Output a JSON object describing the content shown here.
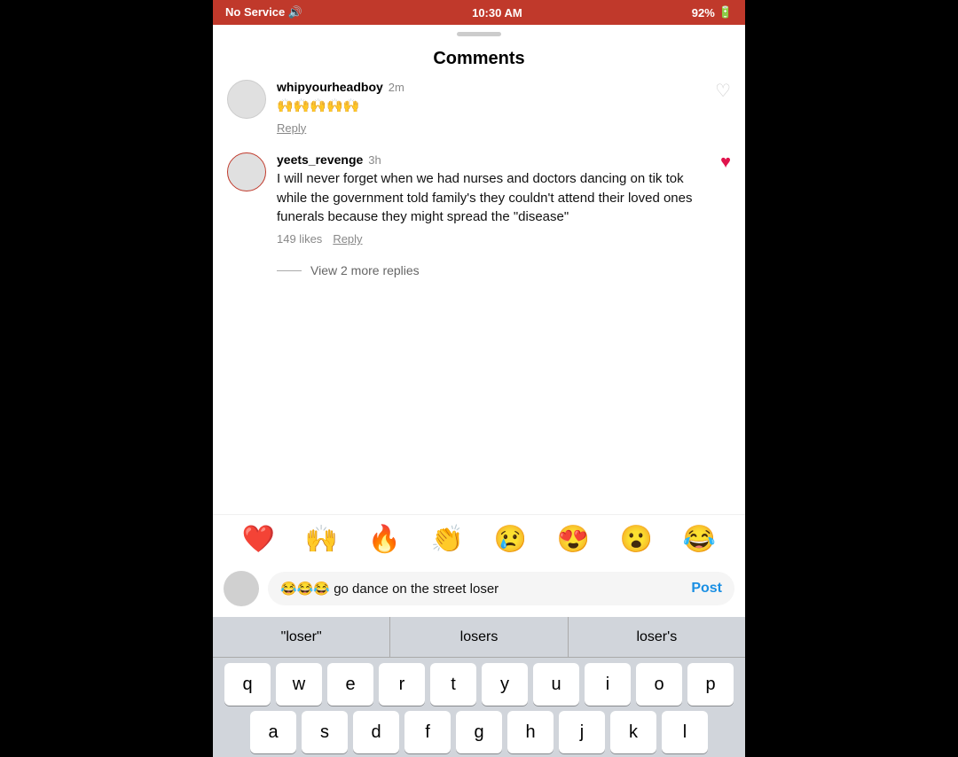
{
  "statusBar": {
    "left": "No Service 🔊",
    "center": "10:30 AM",
    "right": "92%"
  },
  "title": "Comments",
  "comments": [
    {
      "id": "comment-1",
      "username": "whipyourheadboy",
      "time": "2m",
      "text": "🙌🙌🙌🙌🙌",
      "likes": null,
      "liked": false,
      "replyLabel": "Reply"
    },
    {
      "id": "comment-2",
      "username": "yeets_revenge",
      "time": "3h",
      "text": "I will never forget when we had nurses and doctors dancing on tik tok while the government told family's they couldn't attend their loved ones funerals because they might spread the \"disease\"",
      "likes": "149 likes",
      "liked": true,
      "replyLabel": "Reply"
    }
  ],
  "viewMoreReplies": "View 2 more replies",
  "emojiBar": [
    "❤️",
    "🙌",
    "🔥",
    "👏",
    "😢",
    "😍",
    "😮",
    "😂"
  ],
  "inputArea": {
    "inputText": "😂😂😂 go dance on the street loser",
    "postLabel": "Post"
  },
  "autocomplete": {
    "items": [
      "\"loser\"",
      "losers",
      "loser's"
    ]
  },
  "keyboard": {
    "rows": [
      [
        "q",
        "w",
        "e",
        "r",
        "t",
        "y",
        "u",
        "i",
        "o",
        "p"
      ],
      [
        "a",
        "s",
        "d",
        "f",
        "g",
        "h",
        "j",
        "k",
        "l"
      ]
    ]
  }
}
